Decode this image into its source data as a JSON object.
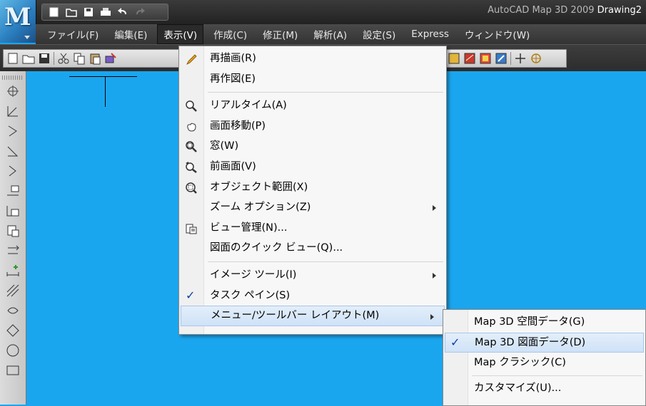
{
  "titlebar": {
    "app_name": "AutoCAD Map 3D 2009",
    "document": "Drawing2"
  },
  "menubar": [
    {
      "label": "ファイル(F)"
    },
    {
      "label": "編集(E)"
    },
    {
      "label": "表示(V)"
    },
    {
      "label": "作成(C)"
    },
    {
      "label": "修正(M)"
    },
    {
      "label": "解析(A)"
    },
    {
      "label": "設定(S)"
    },
    {
      "label": "Express"
    },
    {
      "label": "ウィンドウ(W)"
    }
  ],
  "view_menu": {
    "items": [
      {
        "label": "再描画(R)",
        "icon": "pencil-icon"
      },
      {
        "label": "再作図(E)"
      },
      {
        "label": "リアルタイム(A)",
        "icon": "zoom-realtime-icon"
      },
      {
        "label": "画面移動(P)",
        "icon": "pan-hand-icon"
      },
      {
        "label": "窓(W)",
        "icon": "zoom-window-icon"
      },
      {
        "label": "前画面(V)",
        "icon": "zoom-previous-icon"
      },
      {
        "label": "オブジェクト範囲(X)",
        "icon": "zoom-extents-icon"
      },
      {
        "label": "ズーム オプション(Z)",
        "submenu": true
      },
      {
        "label": "ビュー管理(N)...",
        "icon": "view-manager-icon"
      },
      {
        "label": "図面のクイック ビュー(Q)..."
      },
      {
        "label": "イメージ ツール(I)",
        "submenu": true
      },
      {
        "label": "タスク ペイン(S)",
        "checked": true
      },
      {
        "label": "メニュー/ツールバー レイアウト(M)",
        "submenu": true,
        "highlighted": true
      }
    ]
  },
  "layout_submenu": {
    "items": [
      {
        "label": "Map 3D 空間データ(G)"
      },
      {
        "label": "Map 3D 図面データ(D)",
        "checked": true,
        "highlighted": true
      },
      {
        "label": "Map クラシック(C)"
      },
      {
        "label": "カスタマイズ(U)..."
      }
    ]
  },
  "colors": {
    "canvas": "#1aa6ef",
    "menubar": "#3d3d3d",
    "check": "#0a3ea8"
  }
}
